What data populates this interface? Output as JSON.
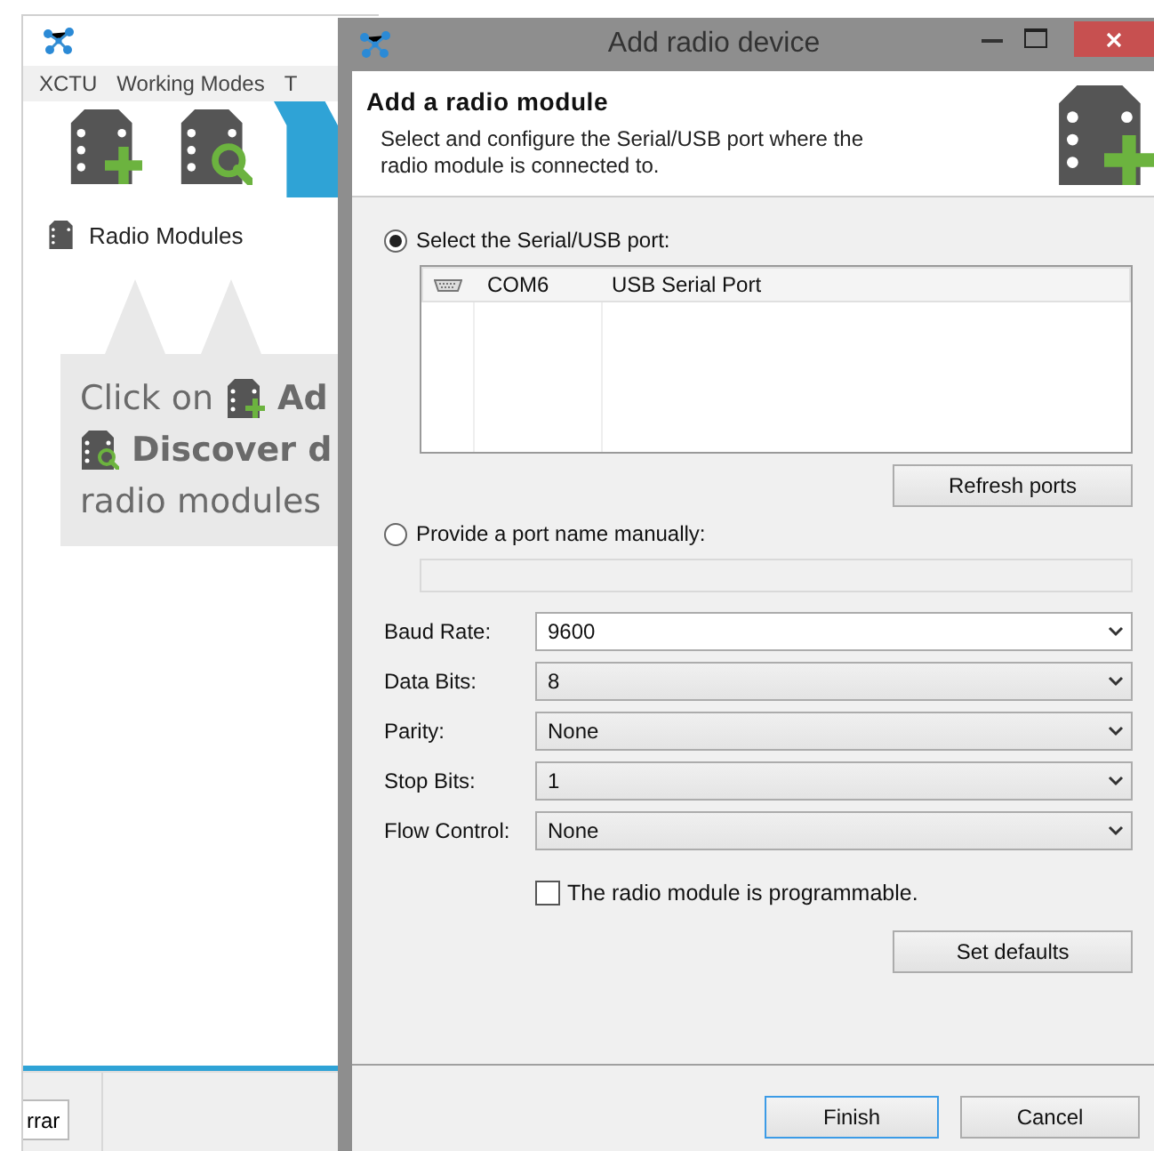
{
  "app": {
    "menu": [
      "XCTU",
      "Working Modes",
      "T"
    ],
    "tree": [
      {
        "label": "Radio Modules"
      }
    ],
    "hint": {
      "line_1": "Click on",
      "line_1_end": "Ad",
      "line_2": "Discover d",
      "line_3": "radio modules"
    },
    "bottom_button": "rrar"
  },
  "dialog": {
    "title": "Add radio device",
    "heading": "Add a radio module",
    "description": "Select and configure the Serial/USB port where the radio module is connected to.",
    "port_options": [
      {
        "label": "Select the Serial/USB port:",
        "selected": true
      },
      {
        "label": "Provide a port name manually:",
        "selected": false
      }
    ],
    "ports": [
      {
        "port": "COM6",
        "description": "USB Serial Port"
      }
    ],
    "refresh_button": "Refresh ports",
    "manual_port": {
      "disabled": true
    },
    "settings": [
      {
        "label": "Baud Rate:",
        "value": "9600",
        "editable": true
      },
      {
        "label": "Data Bits:",
        "value": "8",
        "editable": false
      },
      {
        "label": "Parity:",
        "value": "None",
        "editable": false
      },
      {
        "label": "Stop Bits:",
        "value": "1",
        "editable": false
      },
      {
        "label": "Flow Control:",
        "value": "None",
        "editable": false
      }
    ],
    "programmable": {
      "label": "The radio module is programmable.",
      "checked": false
    },
    "set_defaults_button": "Set defaults",
    "buttons": [
      {
        "label": "Finish",
        "default": true
      },
      {
        "label": "Cancel",
        "default": false
      }
    ]
  }
}
